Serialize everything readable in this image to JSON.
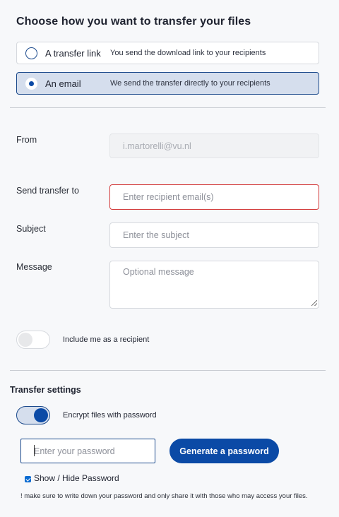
{
  "header": {
    "title": "Choose how you want to transfer your files"
  },
  "transfer_options": [
    {
      "label": "A transfer link",
      "description": "You send the download link to your recipients",
      "selected": false
    },
    {
      "label": "An email",
      "description": "We send the transfer directly to your recipients",
      "selected": true
    }
  ],
  "form": {
    "from": {
      "label": "From",
      "placeholder": "i.martorelli@vu.nl"
    },
    "send_to": {
      "label": "Send transfer to",
      "placeholder": "Enter recipient email(s)"
    },
    "subject": {
      "label": "Subject",
      "placeholder": "Enter the subject"
    },
    "message": {
      "label": "Message",
      "placeholder": "Optional message"
    },
    "include_me": {
      "label": "Include me as a recipient",
      "on": false
    }
  },
  "settings": {
    "title": "Transfer settings",
    "encrypt": {
      "label": "Encrypt files with password",
      "on": true
    },
    "password": {
      "placeholder": "Enter your password"
    },
    "generate_button": "Generate a password",
    "show_hide": {
      "label": "Show / Hide Password",
      "checked": true
    },
    "note": "! make sure to write down your password and only share it with those who may access your files."
  },
  "colors": {
    "accent": "#0b4aa6",
    "selected_bg": "#d5deed",
    "error_border": "#d33b3b",
    "page_bg": "#f7f8fa"
  }
}
